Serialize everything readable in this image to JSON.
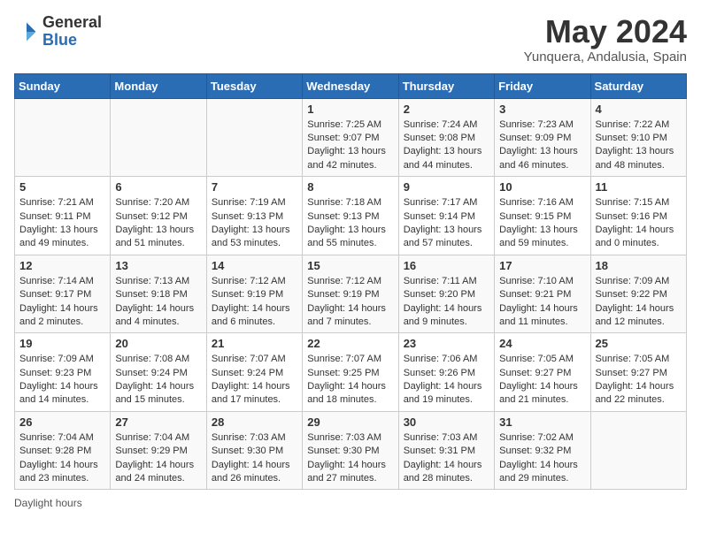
{
  "header": {
    "logo": {
      "general": "General",
      "blue": "Blue"
    },
    "month": "May 2024",
    "location": "Yunquera, Andalusia, Spain"
  },
  "days_of_week": [
    "Sunday",
    "Monday",
    "Tuesday",
    "Wednesday",
    "Thursday",
    "Friday",
    "Saturday"
  ],
  "weeks": [
    [
      {
        "day": "",
        "sunrise": "",
        "sunset": "",
        "daylight": ""
      },
      {
        "day": "",
        "sunrise": "",
        "sunset": "",
        "daylight": ""
      },
      {
        "day": "",
        "sunrise": "",
        "sunset": "",
        "daylight": ""
      },
      {
        "day": "1",
        "sunrise": "Sunrise: 7:25 AM",
        "sunset": "Sunset: 9:07 PM",
        "daylight": "Daylight: 13 hours and 42 minutes."
      },
      {
        "day": "2",
        "sunrise": "Sunrise: 7:24 AM",
        "sunset": "Sunset: 9:08 PM",
        "daylight": "Daylight: 13 hours and 44 minutes."
      },
      {
        "day": "3",
        "sunrise": "Sunrise: 7:23 AM",
        "sunset": "Sunset: 9:09 PM",
        "daylight": "Daylight: 13 hours and 46 minutes."
      },
      {
        "day": "4",
        "sunrise": "Sunrise: 7:22 AM",
        "sunset": "Sunset: 9:10 PM",
        "daylight": "Daylight: 13 hours and 48 minutes."
      }
    ],
    [
      {
        "day": "5",
        "sunrise": "Sunrise: 7:21 AM",
        "sunset": "Sunset: 9:11 PM",
        "daylight": "Daylight: 13 hours and 49 minutes."
      },
      {
        "day": "6",
        "sunrise": "Sunrise: 7:20 AM",
        "sunset": "Sunset: 9:12 PM",
        "daylight": "Daylight: 13 hours and 51 minutes."
      },
      {
        "day": "7",
        "sunrise": "Sunrise: 7:19 AM",
        "sunset": "Sunset: 9:13 PM",
        "daylight": "Daylight: 13 hours and 53 minutes."
      },
      {
        "day": "8",
        "sunrise": "Sunrise: 7:18 AM",
        "sunset": "Sunset: 9:13 PM",
        "daylight": "Daylight: 13 hours and 55 minutes."
      },
      {
        "day": "9",
        "sunrise": "Sunrise: 7:17 AM",
        "sunset": "Sunset: 9:14 PM",
        "daylight": "Daylight: 13 hours and 57 minutes."
      },
      {
        "day": "10",
        "sunrise": "Sunrise: 7:16 AM",
        "sunset": "Sunset: 9:15 PM",
        "daylight": "Daylight: 13 hours and 59 minutes."
      },
      {
        "day": "11",
        "sunrise": "Sunrise: 7:15 AM",
        "sunset": "Sunset: 9:16 PM",
        "daylight": "Daylight: 14 hours and 0 minutes."
      }
    ],
    [
      {
        "day": "12",
        "sunrise": "Sunrise: 7:14 AM",
        "sunset": "Sunset: 9:17 PM",
        "daylight": "Daylight: 14 hours and 2 minutes."
      },
      {
        "day": "13",
        "sunrise": "Sunrise: 7:13 AM",
        "sunset": "Sunset: 9:18 PM",
        "daylight": "Daylight: 14 hours and 4 minutes."
      },
      {
        "day": "14",
        "sunrise": "Sunrise: 7:12 AM",
        "sunset": "Sunset: 9:19 PM",
        "daylight": "Daylight: 14 hours and 6 minutes."
      },
      {
        "day": "15",
        "sunrise": "Sunrise: 7:12 AM",
        "sunset": "Sunset: 9:19 PM",
        "daylight": "Daylight: 14 hours and 7 minutes."
      },
      {
        "day": "16",
        "sunrise": "Sunrise: 7:11 AM",
        "sunset": "Sunset: 9:20 PM",
        "daylight": "Daylight: 14 hours and 9 minutes."
      },
      {
        "day": "17",
        "sunrise": "Sunrise: 7:10 AM",
        "sunset": "Sunset: 9:21 PM",
        "daylight": "Daylight: 14 hours and 11 minutes."
      },
      {
        "day": "18",
        "sunrise": "Sunrise: 7:09 AM",
        "sunset": "Sunset: 9:22 PM",
        "daylight": "Daylight: 14 hours and 12 minutes."
      }
    ],
    [
      {
        "day": "19",
        "sunrise": "Sunrise: 7:09 AM",
        "sunset": "Sunset: 9:23 PM",
        "daylight": "Daylight: 14 hours and 14 minutes."
      },
      {
        "day": "20",
        "sunrise": "Sunrise: 7:08 AM",
        "sunset": "Sunset: 9:24 PM",
        "daylight": "Daylight: 14 hours and 15 minutes."
      },
      {
        "day": "21",
        "sunrise": "Sunrise: 7:07 AM",
        "sunset": "Sunset: 9:24 PM",
        "daylight": "Daylight: 14 hours and 17 minutes."
      },
      {
        "day": "22",
        "sunrise": "Sunrise: 7:07 AM",
        "sunset": "Sunset: 9:25 PM",
        "daylight": "Daylight: 14 hours and 18 minutes."
      },
      {
        "day": "23",
        "sunrise": "Sunrise: 7:06 AM",
        "sunset": "Sunset: 9:26 PM",
        "daylight": "Daylight: 14 hours and 19 minutes."
      },
      {
        "day": "24",
        "sunrise": "Sunrise: 7:05 AM",
        "sunset": "Sunset: 9:27 PM",
        "daylight": "Daylight: 14 hours and 21 minutes."
      },
      {
        "day": "25",
        "sunrise": "Sunrise: 7:05 AM",
        "sunset": "Sunset: 9:27 PM",
        "daylight": "Daylight: 14 hours and 22 minutes."
      }
    ],
    [
      {
        "day": "26",
        "sunrise": "Sunrise: 7:04 AM",
        "sunset": "Sunset: 9:28 PM",
        "daylight": "Daylight: 14 hours and 23 minutes."
      },
      {
        "day": "27",
        "sunrise": "Sunrise: 7:04 AM",
        "sunset": "Sunset: 9:29 PM",
        "daylight": "Daylight: 14 hours and 24 minutes."
      },
      {
        "day": "28",
        "sunrise": "Sunrise: 7:03 AM",
        "sunset": "Sunset: 9:30 PM",
        "daylight": "Daylight: 14 hours and 26 minutes."
      },
      {
        "day": "29",
        "sunrise": "Sunrise: 7:03 AM",
        "sunset": "Sunset: 9:30 PM",
        "daylight": "Daylight: 14 hours and 27 minutes."
      },
      {
        "day": "30",
        "sunrise": "Sunrise: 7:03 AM",
        "sunset": "Sunset: 9:31 PM",
        "daylight": "Daylight: 14 hours and 28 minutes."
      },
      {
        "day": "31",
        "sunrise": "Sunrise: 7:02 AM",
        "sunset": "Sunset: 9:32 PM",
        "daylight": "Daylight: 14 hours and 29 minutes."
      },
      {
        "day": "",
        "sunrise": "",
        "sunset": "",
        "daylight": ""
      }
    ]
  ],
  "footer": {
    "note": "Daylight hours"
  }
}
